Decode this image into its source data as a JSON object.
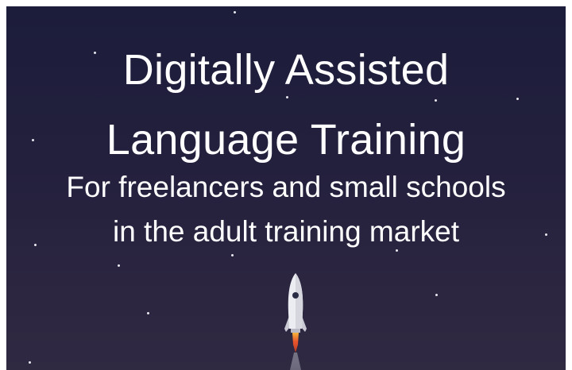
{
  "slide": {
    "title_line_1": "Digitally Assisted",
    "title_line_2": "Language Training",
    "subtitle_line_1": "For freelancers and small schools",
    "subtitle_line_2": "in the adult training market"
  },
  "colors": {
    "background_top": "#1c1d3b",
    "background_bottom": "#2f2942",
    "text": "#ffffff",
    "rocket_body": "#ecedf2",
    "rocket_flame": "#e8552c"
  },
  "icons": {
    "rocket": "rocket-icon",
    "stars": "star-icon"
  }
}
